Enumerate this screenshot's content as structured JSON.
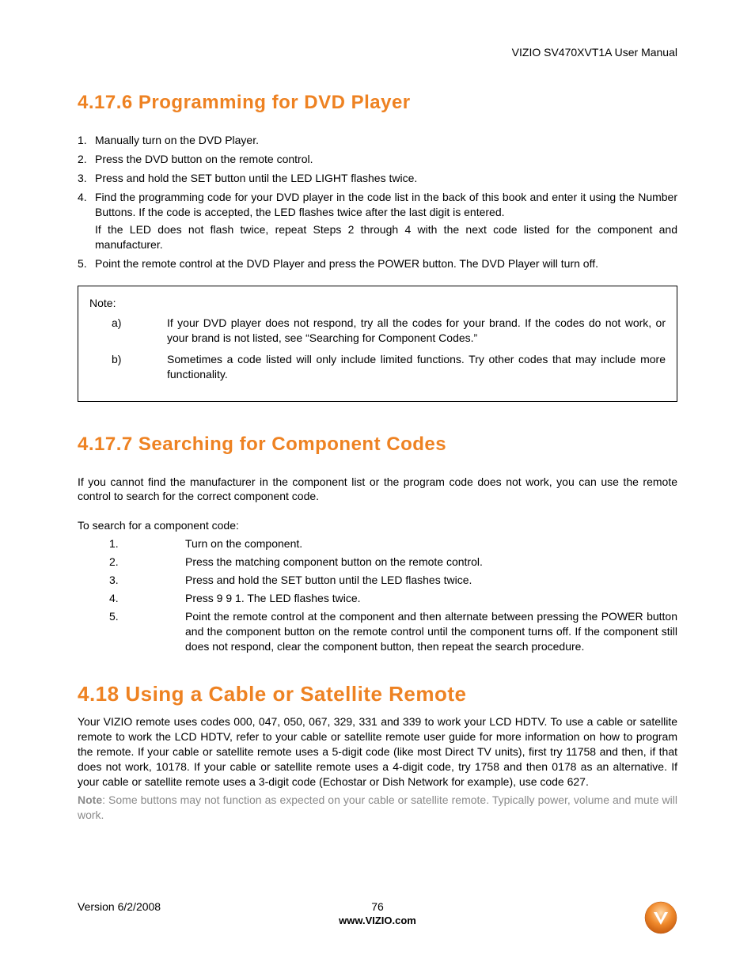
{
  "header": {
    "product_line": "VIZIO SV470XVT1A User Manual"
  },
  "section1": {
    "heading": "4.17.6 Programming for DVD Player",
    "items": [
      {
        "n": "1.",
        "text": "Manually turn on the DVD Player."
      },
      {
        "n": "2.",
        "text": "Press the DVD button on the remote control."
      },
      {
        "n": "3.",
        "text": "Press and hold the SET button until the LED LIGHT flashes twice."
      },
      {
        "n": "4.",
        "text": "Find the programming code for your DVD player in the code list in the back of this book and enter it using the Number Buttons.  If the code is accepted, the LED flashes twice after the last digit is entered.",
        "sub": "If the LED does not flash twice, repeat Steps 2 through 4 with the next code listed for the component and manufacturer."
      },
      {
        "n": "5.",
        "text": "Point the remote control at the DVD Player and press the POWER button.  The DVD Player will turn off."
      }
    ],
    "note_title": "Note:",
    "notes": [
      {
        "m": "a)",
        "text": "If your DVD player does not respond, try all the codes for your brand.  If the codes do not work, or your brand is not listed, see “Searching for Component Codes.”"
      },
      {
        "m": "b)",
        "text": "Sometimes a code listed will only include limited functions.  Try other codes that may include more functionality."
      }
    ]
  },
  "section2": {
    "heading": "4.17.7 Searching for Component Codes",
    "intro": "If you cannot find the manufacturer in the component list or the program code does not work, you can use the remote control to search for the correct component code.",
    "lead": "To search for a component code:",
    "items": [
      {
        "n": "1.",
        "text": "Turn on the component."
      },
      {
        "n": "2.",
        "text": "Press the matching component button on the remote control."
      },
      {
        "n": "3.",
        "text": "Press and hold the SET button until the LED flashes twice."
      },
      {
        "n": "4.",
        "text": "Press 9 9 1.  The LED flashes twice."
      },
      {
        "n": "5.",
        "text": "Point the remote control at the component and then alternate between pressing the POWER button and the component button on the remote control until the component turns off.  If the component still does not respond, clear the component button, then repeat the search procedure."
      }
    ]
  },
  "section3": {
    "heading": "4.18 Using a Cable or Satellite Remote",
    "body": "Your VIZIO remote uses codes 000, 047, 050, 067, 329, 331 and 339 to work your LCD HDTV.  To use a cable or satellite remote to work the LCD HDTV, refer to your cable or satellite remote user guide for more information on how to program the remote.  If your cable or satellite remote uses a 5-digit code (like most Direct TV units), first try 11758 and then, if that does not work, 10178.  If your cable or satellite remote uses a 4-digit code, try 1758 and then 0178 as an alternative.  If your cable or satellite remote uses a 3-digit code (Echostar or Dish Network for example), use code 627.",
    "note_label": "Note",
    "note_text": ": Some buttons may not function as expected on your cable or satellite remote.  Typically power, volume and mute will work."
  },
  "footer": {
    "version": "Version 6/2/2008",
    "page": "76",
    "url": "www.VIZIO.com"
  }
}
